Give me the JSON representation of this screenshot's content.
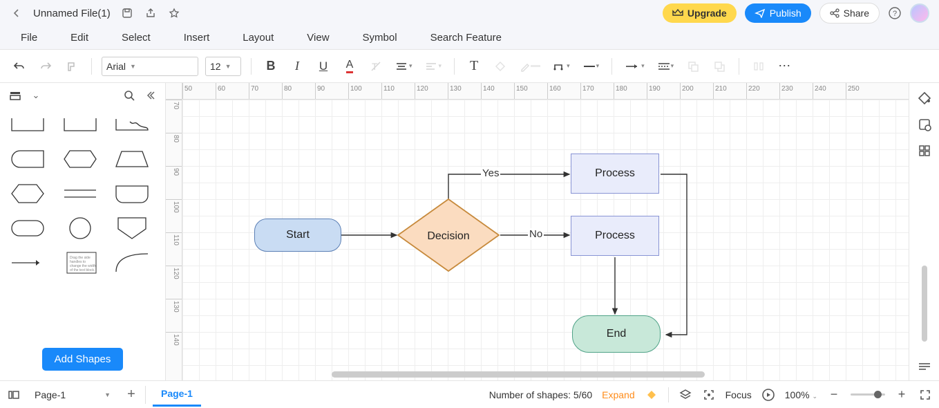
{
  "title": {
    "filename": "Unnamed File(1)"
  },
  "topbuttons": {
    "upgrade": "Upgrade",
    "publish": "Publish",
    "share": "Share"
  },
  "menu": {
    "file": "File",
    "edit": "Edit",
    "select": "Select",
    "insert": "Insert",
    "layout": "Layout",
    "view": "View",
    "symbol": "Symbol",
    "search": "Search Feature"
  },
  "toolbar": {
    "font": "Arial",
    "size": "12"
  },
  "shapes": {
    "add": "Add Shapes"
  },
  "ruler_h": [
    "50",
    "60",
    "70",
    "80",
    "90",
    "100",
    "110",
    "120",
    "130",
    "140",
    "150",
    "160",
    "170",
    "180",
    "190",
    "200",
    "210",
    "220",
    "230",
    "240",
    "250"
  ],
  "ruler_v": [
    "70",
    "80",
    "90",
    "100",
    "110",
    "120",
    "130",
    "140"
  ],
  "nodes": {
    "start": "Start",
    "decision": "Decision",
    "proc1": "Process",
    "proc2": "Process",
    "end": "End",
    "yes": "Yes",
    "no": "No"
  },
  "status": {
    "page_sel": "Page-1",
    "tab": "Page-1",
    "shapes_cnt": "Number of shapes: 5/60",
    "expand": "Expand",
    "focus": "Focus",
    "zoom": "100%"
  }
}
